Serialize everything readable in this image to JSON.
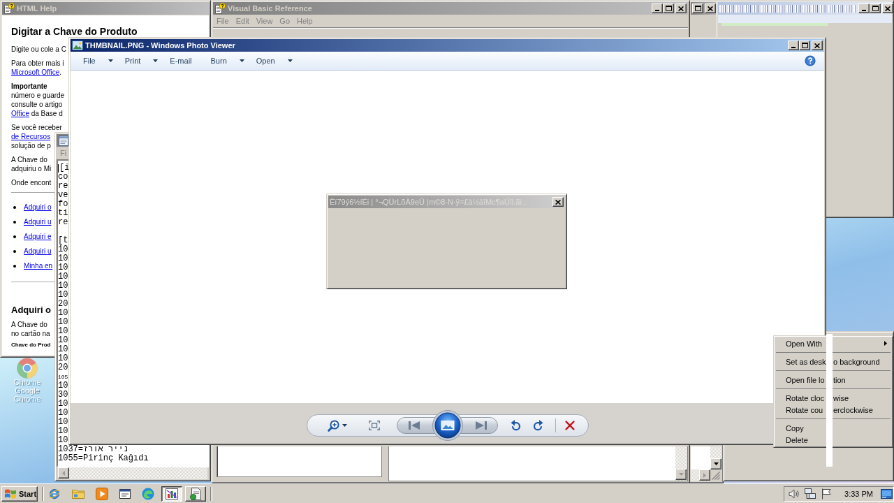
{
  "desktop": {
    "icons": [
      {
        "ghost_label": "Chrome",
        "label": "Google Chrome"
      }
    ]
  },
  "help_window": {
    "active": false,
    "title": "HTML Help",
    "heading": "Digitar a Chave do Produto",
    "blocks": [
      {
        "kind": "paragraph",
        "lines": [
          [
            {
              "kind": "text",
              "text": "Digite ou cole a C"
            }
          ]
        ]
      },
      {
        "kind": "paragraph",
        "lines": [
          [
            {
              "kind": "text",
              "text": "Para obter mais i"
            }
          ],
          [
            {
              "kind": "link",
              "text": "Microsoft Office"
            },
            {
              "kind": "text",
              "text": "."
            }
          ]
        ]
      },
      {
        "kind": "paragraph",
        "lines": [
          [
            {
              "kind": "bold",
              "text": "Importante"
            }
          ],
          [
            {
              "kind": "text",
              "text": "número e guarde"
            }
          ],
          [
            {
              "kind": "text",
              "text": "consulte o artigo"
            }
          ],
          [
            {
              "kind": "link",
              "text": "Office"
            },
            {
              "kind": "text",
              "text": " da Base d"
            }
          ]
        ]
      },
      {
        "kind": "paragraph",
        "lines": [
          [
            {
              "kind": "text",
              "text": "Se você receber"
            }
          ],
          [
            {
              "kind": "link",
              "text": "de Recursos"
            }
          ],
          [
            {
              "kind": "text",
              "text": "solução de p"
            }
          ]
        ]
      },
      {
        "kind": "paragraph",
        "lines": [
          [
            {
              "kind": "text",
              "text": "A Chave do"
            }
          ],
          [
            {
              "kind": "text",
              "text": "adquiriu o Mi"
            }
          ]
        ]
      },
      {
        "kind": "paragraph",
        "lines": [
          [
            {
              "kind": "text",
              "text": "Onde encont"
            }
          ]
        ]
      },
      {
        "kind": "rule"
      },
      {
        "kind": "bullets",
        "items": [
          "Adquiri o",
          "Adquiri u",
          "Adquiri e",
          "Adquiri u",
          "Minha en"
        ]
      },
      {
        "kind": "rule"
      },
      {
        "kind": "subheading",
        "text": "Adquiri o"
      },
      {
        "kind": "paragraph",
        "lines": [
          [
            {
              "kind": "text",
              "text": "A Chave do"
            }
          ],
          [
            {
              "kind": "text",
              "text": "no cartão na"
            }
          ]
        ]
      },
      {
        "kind": "note",
        "text": "Chave do Prod"
      }
    ]
  },
  "vb_window": {
    "active": false,
    "title": "Visual Basic Reference",
    "menu": [
      "File",
      "Edit",
      "View",
      "Go",
      "Help"
    ]
  },
  "right_window": {
    "active": false
  },
  "notepad": {
    "active": false,
    "menu": [
      "Fi"
    ],
    "sections": [
      [
        {
          "kind": "normal",
          "text": "[i"
        },
        {
          "kind": "normal",
          "text": "co"
        },
        {
          "kind": "normal",
          "text": "re"
        },
        {
          "kind": "normal",
          "text": "ve"
        },
        {
          "kind": "normal",
          "text": "fo"
        },
        {
          "kind": "normal",
          "text": "ti"
        },
        {
          "kind": "normal",
          "text": "re"
        }
      ],
      [
        {
          "kind": "normal",
          "text": "[t"
        },
        {
          "kind": "normal",
          "text": "10"
        },
        {
          "kind": "normal",
          "text": "10"
        },
        {
          "kind": "normal",
          "text": "10"
        },
        {
          "kind": "normal",
          "text": "10"
        },
        {
          "kind": "normal",
          "text": "10"
        },
        {
          "kind": "normal",
          "text": "10"
        },
        {
          "kind": "normal",
          "text": "20"
        },
        {
          "kind": "normal",
          "text": "10"
        },
        {
          "kind": "normal",
          "text": "10"
        },
        {
          "kind": "normal",
          "text": "10"
        },
        {
          "kind": "normal",
          "text": "10"
        },
        {
          "kind": "normal",
          "text": "10"
        },
        {
          "kind": "normal",
          "text": "10"
        },
        {
          "kind": "normal",
          "text": "20"
        },
        {
          "kind": "small",
          "text": "105"
        },
        {
          "kind": "normal",
          "text": "10"
        },
        {
          "kind": "normal",
          "text": "30"
        },
        {
          "kind": "normal",
          "text": "10"
        },
        {
          "kind": "normal",
          "text": "10"
        },
        {
          "kind": "normal",
          "text": "10"
        },
        {
          "kind": "normal",
          "text": "10"
        },
        {
          "kind": "normal",
          "text": "10"
        },
        {
          "kind": "normal",
          "text": "1037=נייר אורז"
        },
        {
          "kind": "normal",
          "text": "1055=Pirinç Kağıdı"
        }
      ]
    ]
  },
  "photo_viewer": {
    "active": true,
    "title": "THMBNAIL.PNG - Windows Photo Viewer",
    "menu": [
      {
        "label": "File",
        "dropdown": true
      },
      {
        "label": "Print",
        "dropdown": true
      },
      {
        "label": "E-mail",
        "dropdown": false
      },
      {
        "label": "Burn",
        "dropdown": true
      },
      {
        "label": "Open",
        "dropdown": true
      }
    ]
  },
  "dialog": {
    "active": false,
    "title": "Êï79ý6½íÉi | °¬QÜrLõÀ9eÜ |m©8·N·ÿ=£à½äîMc¶aÜîl.ãì.."
  },
  "context_menu": {
    "items": [
      {
        "kind": "item",
        "label": "Open With",
        "submenu": true
      },
      {
        "kind": "separator"
      },
      {
        "kind": "item",
        "label": "Set as desk",
        "label_right": "o background",
        "submenu": false
      },
      {
        "kind": "separator"
      },
      {
        "kind": "item",
        "label": "Open file lo",
        "label_right": "tion",
        "submenu": false
      },
      {
        "kind": "separator"
      },
      {
        "kind": "item",
        "label": "Rotate cloc",
        "label_right": "wise",
        "submenu": false
      },
      {
        "kind": "item",
        "label": "Rotate cou",
        "label_right": "erclockwise",
        "submenu": false
      },
      {
        "kind": "separator"
      },
      {
        "kind": "item",
        "label": "Copy",
        "submenu": false
      },
      {
        "kind": "item",
        "label": "Delete",
        "submenu": false
      }
    ]
  },
  "taskbar": {
    "start": "Start",
    "tasks": [
      {
        "selected": true
      },
      {
        "selected": false
      }
    ],
    "clock": "3:33 PM"
  }
}
